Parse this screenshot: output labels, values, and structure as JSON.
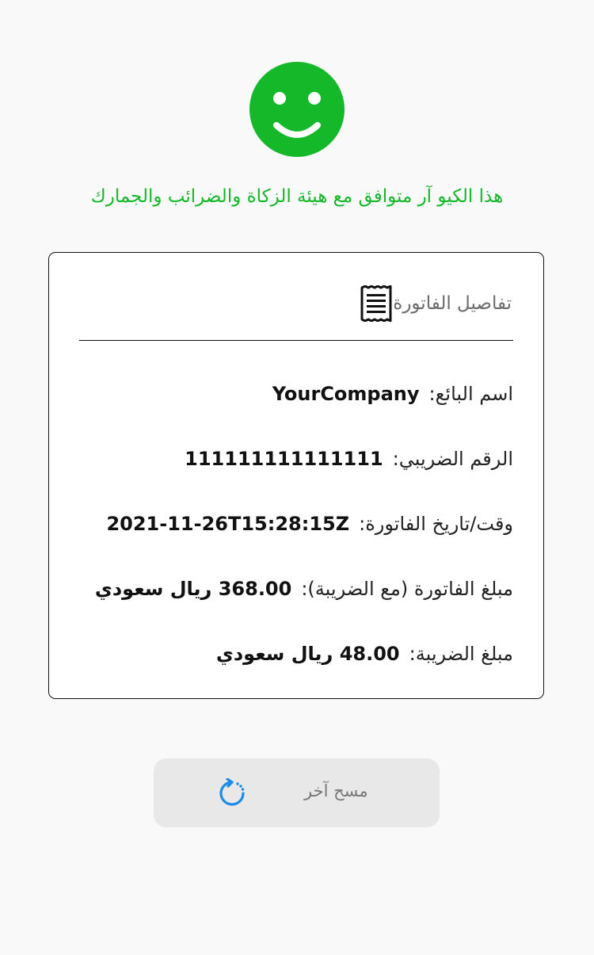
{
  "status": {
    "icon": "smiley-face-icon",
    "color": "#14b829",
    "message": "هذا الكيو آر متوافق مع هيئة الزكاة والضرائب والجمارك"
  },
  "invoice": {
    "title": "تفاصيل الفاتورة",
    "icon": "receipt-icon",
    "fields": [
      {
        "label": "اسم البائع:",
        "value": "YourCompany"
      },
      {
        "label": "الرقم الضريبي:",
        "value": "111111111111111"
      },
      {
        "label": "وقت/تاريخ الفاتورة:",
        "value": "2021-11-26T15:28:15Z"
      },
      {
        "label": "مبلغ الفاتورة (مع الضريبة):",
        "value": "368.00 ريال سعودي"
      },
      {
        "label": "مبلغ الضريبة:",
        "value": "48.00 ريال سعودي"
      }
    ]
  },
  "actions": {
    "scan_again_label": "مسح آخر",
    "scan_again_icon": "refresh-icon",
    "accent": "#1a8ce8"
  }
}
